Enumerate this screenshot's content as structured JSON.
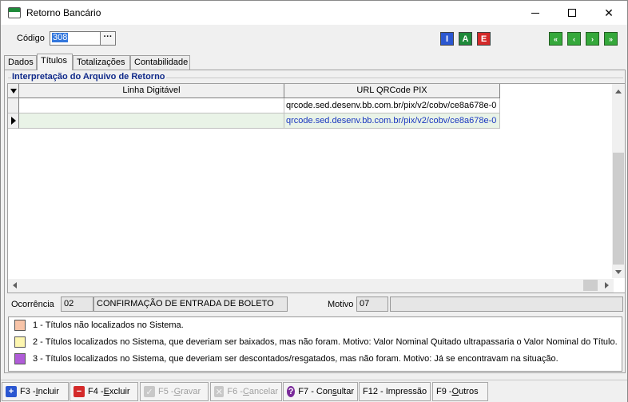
{
  "window": {
    "title": "Retorno Bancário",
    "app_icon": "app-window-icon"
  },
  "toolbar": {
    "codigo_label": "Código",
    "codigo_value": "308",
    "lookup_label": "···",
    "i_label": "I",
    "a_label": "A",
    "e_label": "E",
    "nav": [
      "«",
      "‹",
      "›",
      "»"
    ]
  },
  "tabs": [
    {
      "label": "Dados",
      "active": false
    },
    {
      "label": "Títulos",
      "active": true
    },
    {
      "label": "Totalizações",
      "active": false
    },
    {
      "label": "Contabilidade",
      "active": false
    }
  ],
  "section_title": "Interpretação do Arquivo de Retorno",
  "grid": {
    "columns": [
      "Linha Digitável",
      "URL QRCode PIX"
    ],
    "rows": [
      {
        "linha": "",
        "url": "qrcode.sed.desenv.bb.com.br/pix/v2/cobv/ce8a678e-0",
        "selected": false
      },
      {
        "linha": "",
        "url": "qrcode.sed.desenv.bb.com.br/pix/v2/cobv/ce8a678e-0",
        "selected": true
      }
    ]
  },
  "ocorrencia": {
    "label": "Ocorrência",
    "code": "02",
    "description": "CONFIRMAÇÃO DE ENTRADA DE BOLETO",
    "motivo_label": "Motivo",
    "motivo_code": "07",
    "motivo_description": ""
  },
  "legend": [
    {
      "color": "#f8c4a8",
      "text": "1 - Títulos não localizados no Sistema."
    },
    {
      "color": "#fdf6b0",
      "text": "2 - Títulos localizados no Sistema, que deveriam ser baixados, mas não foram. Motivo: Valor Nominal Quitado ultrapassaria o Valor Nominal do Título."
    },
    {
      "color": "#b05cd8",
      "text": "3 - Títulos localizados no Sistema, que deveriam ser descontados/resgatados, mas não foram. Motivo: Já se encontravam na situação."
    }
  ],
  "bottom": {
    "incluir": {
      "prefix": "F3 - ",
      "key": "I",
      "rest": "ncluir"
    },
    "excluir": {
      "prefix": "F4 - ",
      "key": "E",
      "rest": "xcluir"
    },
    "gravar": {
      "prefix": "F5 - ",
      "key": "G",
      "rest": "ravar"
    },
    "cancelar": {
      "prefix": "F6 - ",
      "key": "C",
      "rest": "ancelar"
    },
    "consultar": {
      "prefix": "F7 - Con",
      "key": "s",
      "rest": "ultar"
    },
    "impressao": {
      "label": "F12 - Impressão"
    },
    "outros": {
      "prefix": "F9 - ",
      "key": "O",
      "rest": "utros"
    }
  }
}
